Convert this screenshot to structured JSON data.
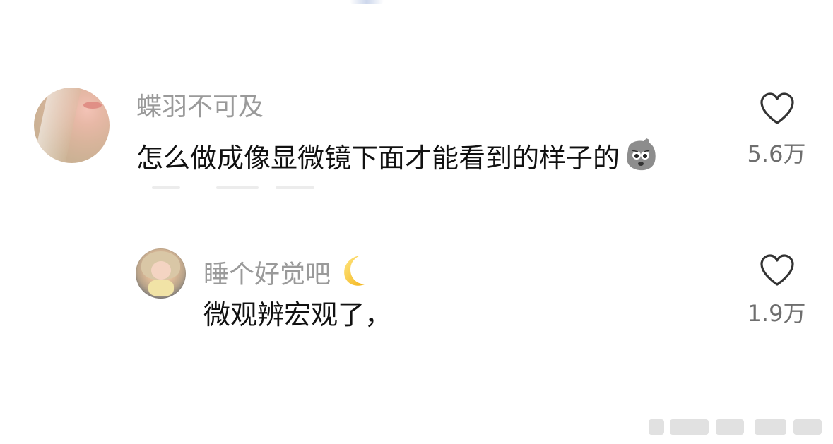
{
  "comments": [
    {
      "username": "蝶羽不可及",
      "text": "怎么做成像显微镜下面才能看到的样子的",
      "emoji": "sad-face-emoji",
      "likes": "5.6万"
    },
    {
      "username": "睡个好觉吧",
      "username_emoji": "crescent-moon-emoji",
      "text": "微观辨宏观了，",
      "likes": "1.9万"
    }
  ],
  "icons": {
    "like": "heart-outline-icon"
  },
  "colors": {
    "username": "#9a9a9a",
    "text": "#111111",
    "likes": "#6e6e6e",
    "heart_stroke": "#333333"
  }
}
